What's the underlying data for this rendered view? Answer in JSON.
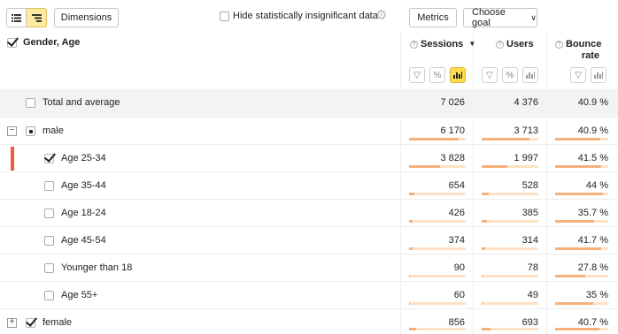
{
  "toolbar": {
    "list_view_icon": "list-icon",
    "tree_view_icon": "tree-icon",
    "dimensions_label": "Dimensions",
    "hide_insignificant_label": "Hide statistically insignificant data",
    "metrics_label": "Metrics",
    "choose_goal_label": "Choose goal"
  },
  "header": {
    "dimension_title": "Gender, Age",
    "columns": [
      {
        "label": "Sessions",
        "sort": "▼"
      },
      {
        "label": "Users"
      },
      {
        "label": "Bounce rate"
      }
    ]
  },
  "rows": [
    {
      "label": "Total and average",
      "sessions": "7 026",
      "users": "4 376",
      "bounce": "40.9 %"
    },
    {
      "label": "male",
      "sessions": "6 170",
      "users": "3 713",
      "bounce": "40.9 %",
      "sessions_frac": 0.88,
      "users_frac": 0.85,
      "bounce_frac": 0.85
    },
    {
      "label": "Age 25-34",
      "sessions": "3 828",
      "users": "1 997",
      "bounce": "41.5 %",
      "sessions_frac": 0.55,
      "users_frac": 0.46,
      "bounce_frac": 0.86
    },
    {
      "label": "Age 35-44",
      "sessions": "654",
      "users": "528",
      "bounce": "44 %",
      "sessions_frac": 0.1,
      "users_frac": 0.12,
      "bounce_frac": 0.9
    },
    {
      "label": "Age 18-24",
      "sessions": "426",
      "users": "385",
      "bounce": "35.7 %",
      "sessions_frac": 0.07,
      "users_frac": 0.09,
      "bounce_frac": 0.74
    },
    {
      "label": "Age 45-54",
      "sessions": "374",
      "users": "314",
      "bounce": "41.7 %",
      "sessions_frac": 0.06,
      "users_frac": 0.07,
      "bounce_frac": 0.86
    },
    {
      "label": "Younger than 18",
      "sessions": "90",
      "users": "78",
      "bounce": "27.8 %",
      "sessions_frac": 0.02,
      "users_frac": 0.02,
      "bounce_frac": 0.57
    },
    {
      "label": "Age 55+",
      "sessions": "60",
      "users": "49",
      "bounce": "35 %",
      "sessions_frac": 0.01,
      "users_frac": 0.01,
      "bounce_frac": 0.72
    },
    {
      "label": "female",
      "sessions": "856",
      "users": "693",
      "bounce": "40.7 %",
      "sessions_frac": 0.12,
      "users_frac": 0.16,
      "bounce_frac": 0.84
    }
  ],
  "colors": {
    "accent": "#ffdb4d",
    "bar": "#f6b17a",
    "bar_bg": "#fde2c5",
    "marker": "#ee5a3c"
  }
}
